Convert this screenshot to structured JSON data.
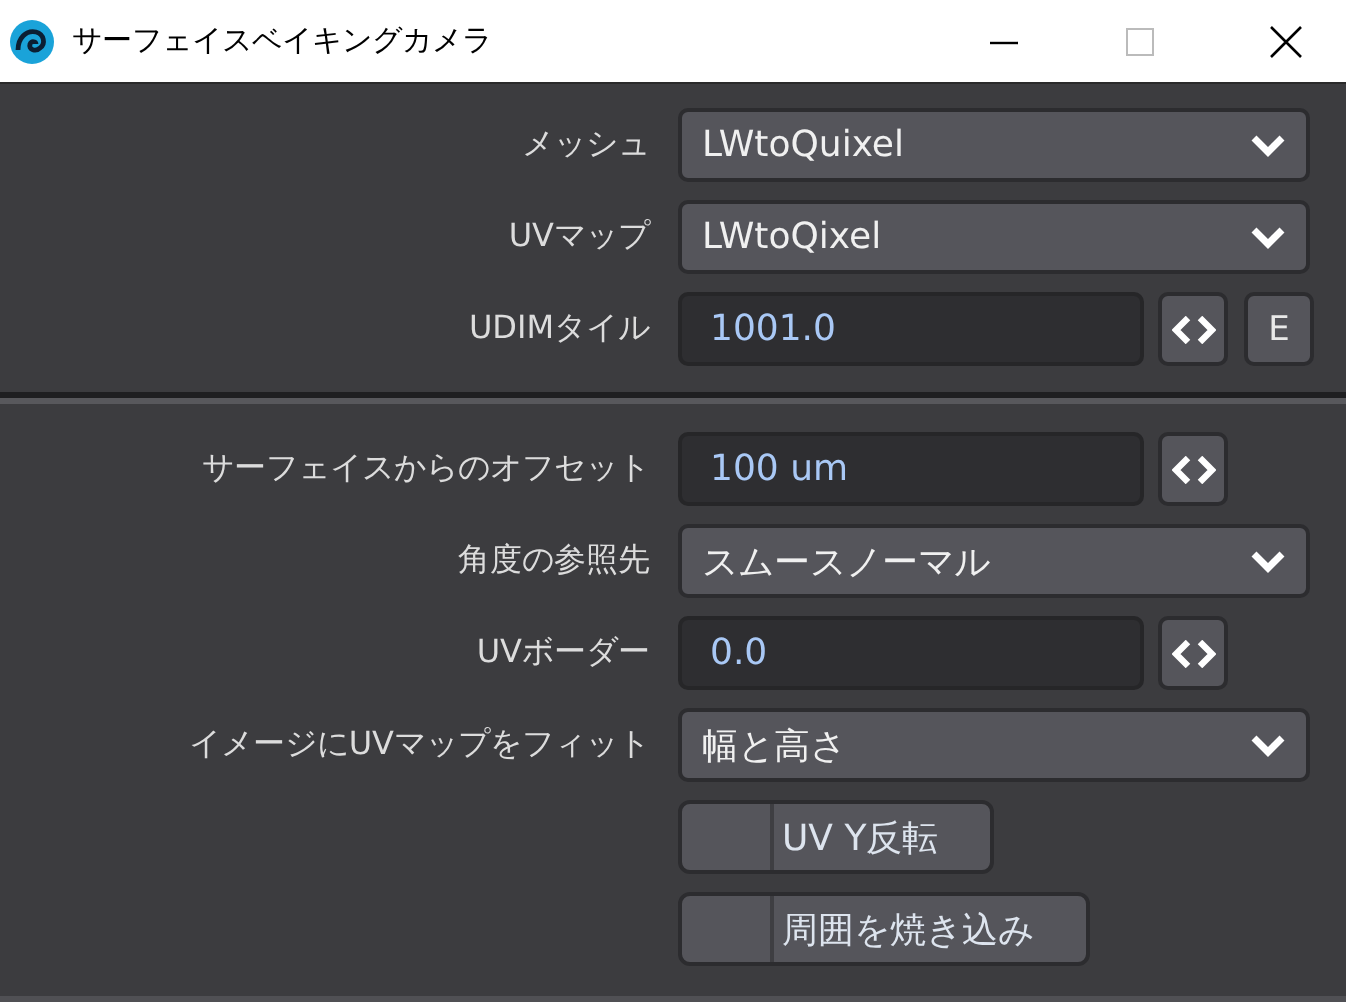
{
  "window": {
    "title": "サーフェイスベイキングカメラ"
  },
  "sections": [
    {
      "rows": [
        {
          "kind": "dropdown",
          "label": "メッシュ",
          "value": "LWtoQuixel"
        },
        {
          "kind": "dropdown",
          "label": "UVマップ",
          "value": "LWtoQixel"
        },
        {
          "kind": "number",
          "label": "UDIMタイル",
          "value": "1001.0",
          "extra_button": "E"
        }
      ]
    },
    {
      "rows": [
        {
          "kind": "number",
          "label": "サーフェイスからのオフセット",
          "value": "100 um"
        },
        {
          "kind": "dropdown",
          "label": "角度の参照先",
          "value": "スムースノーマル"
        },
        {
          "kind": "number",
          "label": "UVボーダー",
          "value": "0.0"
        },
        {
          "kind": "dropdown",
          "label": "イメージにUVマップをフィット",
          "value": "幅と高さ"
        },
        {
          "kind": "toggle",
          "text": "UV Y反転",
          "checked": false
        },
        {
          "kind": "toggle",
          "text": "周囲を焼き込み",
          "checked": false
        }
      ]
    }
  ]
}
